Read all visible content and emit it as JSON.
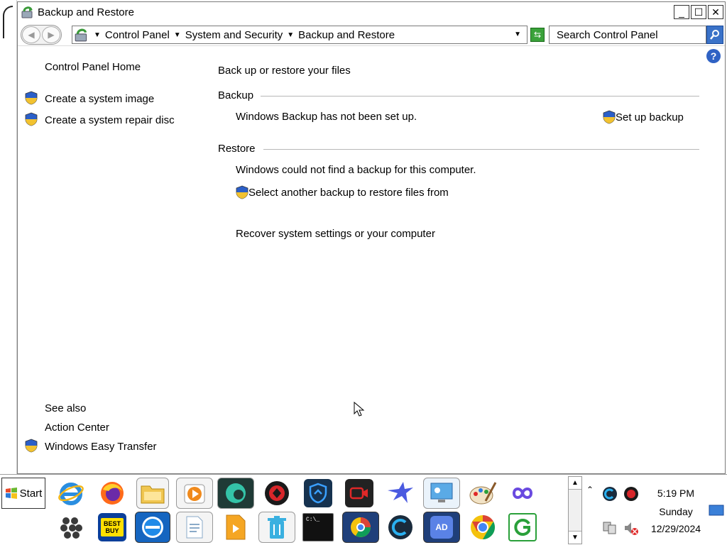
{
  "window": {
    "title": "Backup and Restore",
    "controls": {
      "minimize": "_",
      "maximize": "☐",
      "close": "✕"
    }
  },
  "address": {
    "crumbs": [
      "Control Panel",
      "System and Security",
      "Backup and Restore"
    ]
  },
  "search": {
    "placeholder": "Search Control Panel"
  },
  "help": "?",
  "left_pane": {
    "home": "Control Panel Home",
    "tasks": [
      "Create a system image",
      "Create a system repair disc"
    ],
    "see_also_heading": "See also",
    "see_also": [
      "Action Center",
      "Windows Easy Transfer"
    ]
  },
  "content": {
    "heading": "Back up or restore your files",
    "backup": {
      "title": "Backup",
      "status": "Windows Backup has not been set up.",
      "action": "Set up backup"
    },
    "restore": {
      "title": "Restore",
      "status": "Windows could not find a backup for this computer.",
      "action": "Select another backup to restore files from",
      "recover": "Recover system settings or your computer"
    }
  },
  "taskbar": {
    "start_label": "Start",
    "best_buy_label": "BEST BUY",
    "adblock_label": "AD",
    "cmd_label": "C:\\_"
  },
  "clock": {
    "time": "5:19 PM",
    "day": "Sunday",
    "date": "12/29/2024"
  },
  "colors": {
    "accent": "#2f62c4",
    "shield_blue": "#2b5fc8",
    "shield_yellow": "#f2c230"
  }
}
